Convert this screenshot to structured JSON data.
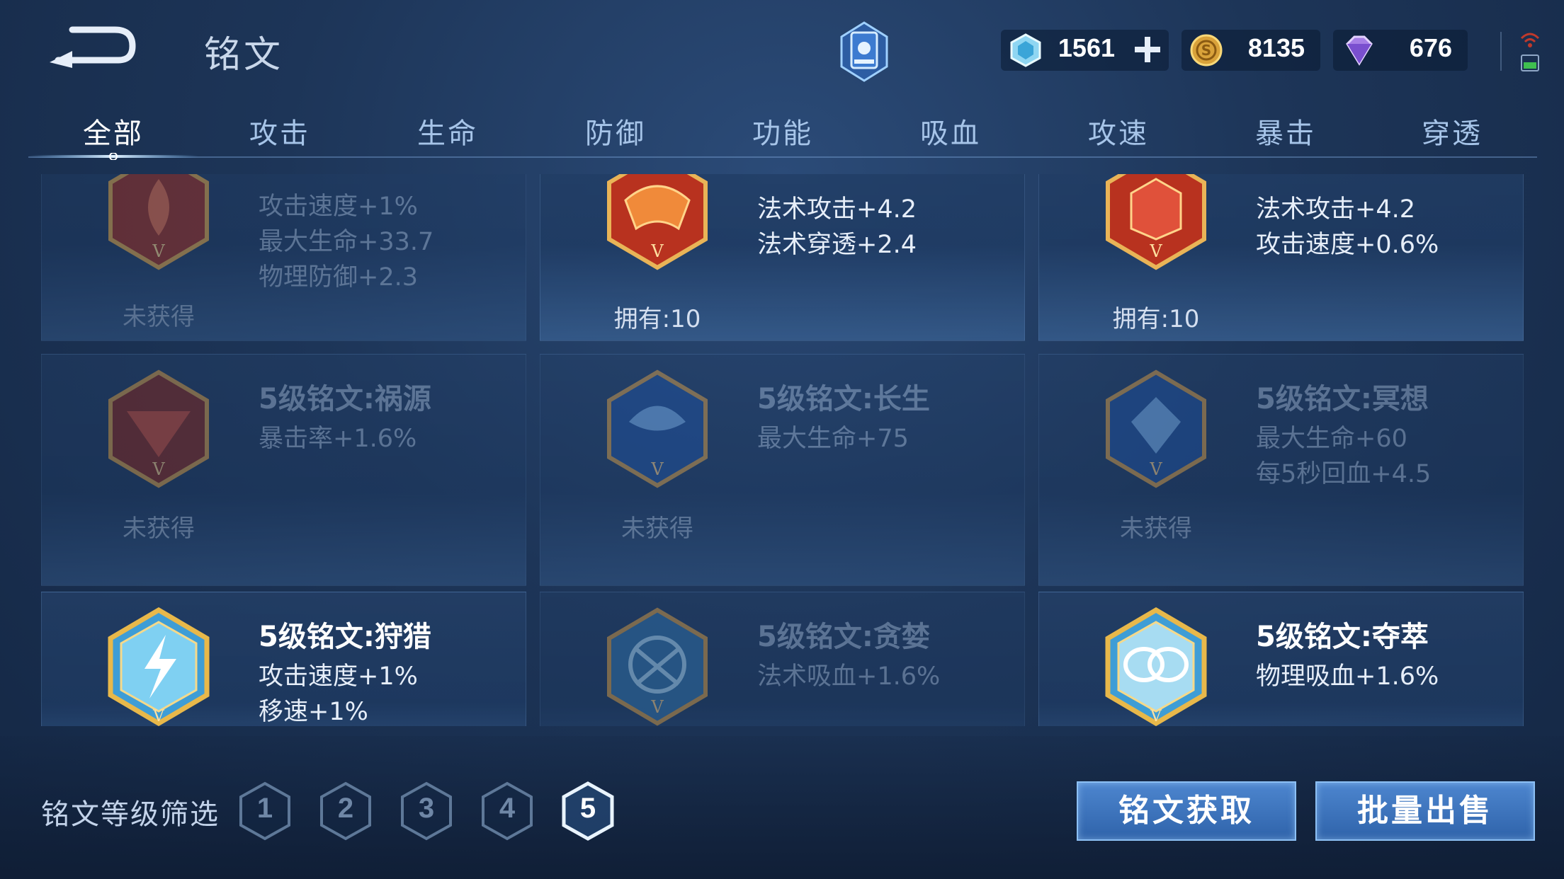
{
  "header": {
    "title": "铭文"
  },
  "resources": [
    {
      "icon": "crystal-icon",
      "value": "1561"
    },
    {
      "icon": "coin-icon",
      "value": "8135"
    },
    {
      "icon": "diamond-icon",
      "value": "676"
    }
  ],
  "tabs": [
    "全部",
    "攻击",
    "生命",
    "防御",
    "功能",
    "吸血",
    "攻速",
    "暴击",
    "穿透"
  ],
  "active_tab": "全部",
  "cards": [
    {
      "stats": [
        "攻击速度+1%",
        "最大生命+33.7",
        "物理防御+2.3"
      ],
      "status": "未获得",
      "owned": false,
      "color": "#b03a2e"
    },
    {
      "stats": [
        "法术攻击+4.2",
        "法术穿透+2.4"
      ],
      "status": "拥有:10",
      "owned": true,
      "color": "#c8392b"
    },
    {
      "stats": [
        "法术攻击+4.2",
        "攻击速度+0.6%"
      ],
      "status": "拥有:10",
      "owned": true,
      "color": "#c8392b"
    },
    {
      "name": "5级铭文:祸源",
      "stats": [
        "暴击率+1.6%"
      ],
      "status": "未获得",
      "owned": false,
      "color": "#b03a2e"
    },
    {
      "name": "5级铭文:长生",
      "stats": [
        "最大生命+75"
      ],
      "status": "未获得",
      "owned": false,
      "color": "#2b6bc4"
    },
    {
      "name": "5级铭文:冥想",
      "stats": [
        "最大生命+60",
        "每5秒回血+4.5"
      ],
      "status": "未获得",
      "owned": false,
      "color": "#2b6bc4"
    },
    {
      "name": "5级铭文:狩猎",
      "stats": [
        "攻击速度+1%",
        "移速+1%"
      ],
      "owned": true,
      "color": "#4fb3e6"
    },
    {
      "name": "5级铭文:贪婪",
      "stats": [
        "法术吸血+1.6%"
      ],
      "owned": false,
      "color": "#4fb3e6"
    },
    {
      "name": "5级铭文:夺萃",
      "stats": [
        "物理吸血+1.6%"
      ],
      "owned": true,
      "color": "#4fb3e6"
    }
  ],
  "filter": {
    "label": "铭文等级筛选",
    "levels": [
      "1",
      "2",
      "3",
      "4",
      "5"
    ],
    "active": "5"
  },
  "buttons": {
    "obtain": "铭文获取",
    "sell": "批量出售"
  },
  "colors": {
    "accent": "#4d86cf",
    "background": "#1d3558",
    "gold": "#e8b84a"
  }
}
